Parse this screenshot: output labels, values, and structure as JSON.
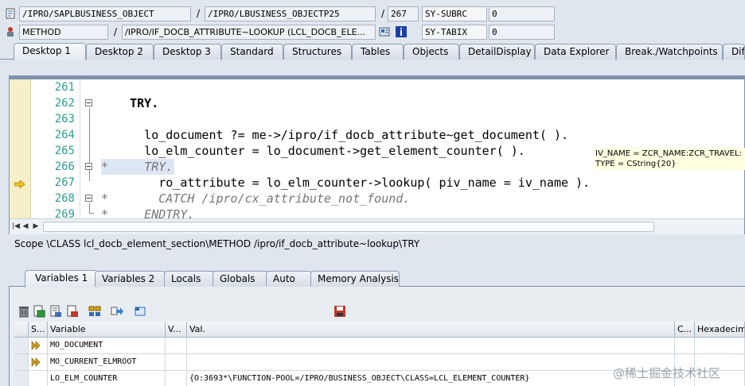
{
  "header": {
    "program": "/IPRO/SAPLBUSINESS_OBJECT",
    "include": "/IPRO/LBUSINESS_OBJECTP25",
    "line": "267",
    "sy_subrc_label": "SY-SUBRC",
    "sy_subrc_value": "0",
    "event_type": "METHOD",
    "event": "/IPRO/IF_DOCB_ATTRIBUTE~LOOKUP (LCL_DOCB_ELE...",
    "sy_tabix_label": "SY-TABIX",
    "sy_tabix_value": "0"
  },
  "top_tabs": [
    "Desktop 1",
    "Desktop 2",
    "Desktop 3",
    "Standard",
    "Structures",
    "Tables",
    "Objects",
    "DetailDisplay",
    "Data Explorer",
    "Break./Watchpoints",
    "Dif"
  ],
  "editor": {
    "lines": [
      {
        "num": "261",
        "text": ""
      },
      {
        "num": "262",
        "text": "    TRY."
      },
      {
        "num": "263",
        "text": ""
      },
      {
        "num": "264",
        "text": "      lo_document ?= me->/ipro/if_docb_attribute~get_document( )."
      },
      {
        "num": "265",
        "text": "      lo_elm_counter = lo_document->get_element_counter( )."
      },
      {
        "num": "266",
        "text": "*     TRY."
      },
      {
        "num": "267",
        "text": "        ro_attribute = lo_elm_counter->lookup( piv_name = iv_name )."
      },
      {
        "num": "268",
        "text": "*       CATCH /ipro/cx_attribute_not_found."
      },
      {
        "num": "269",
        "text": "*     ENDTRY."
      }
    ],
    "tooltip_line1": "IV_NAME = ZCR_NAME:ZCR_TRAVEL:",
    "tooltip_line2": "TYPE  = CString{20}",
    "scope": "Scope \\CLASS lcl_docb_element_section\\METHOD /ipro/if_docb_attribute~lookup\\TRY"
  },
  "bottom_tabs": [
    "Variables 1",
    "Variables 2",
    "Locals",
    "Globals",
    "Auto",
    "Memory Analysis"
  ],
  "variables": {
    "headers": {
      "s": "S...",
      "variable": "Variable",
      "v": "V...",
      "val": "Val.",
      "c": "C...",
      "hex": "Hexadecim"
    },
    "rows": [
      {
        "name": "MO_DOCUMENT",
        "value": ""
      },
      {
        "name": "MO_CURRENT_ELMROOT",
        "value": ""
      },
      {
        "name": "LO_ELM_COUNTER",
        "value": "{O:3693*\\FUNCTION-POOL=/IPRO/BUSINESS_OBJECT\\CLASS=LCL_ELEMENT_COUNTER}"
      }
    ]
  },
  "watermark": "@稀土掘金技术社区",
  "colors": {
    "line_numbers": "#2e9a8f",
    "comment": "#777777",
    "tooltip_bg": "#ffffe1",
    "breakpoint_arrow": "#f0c419"
  }
}
